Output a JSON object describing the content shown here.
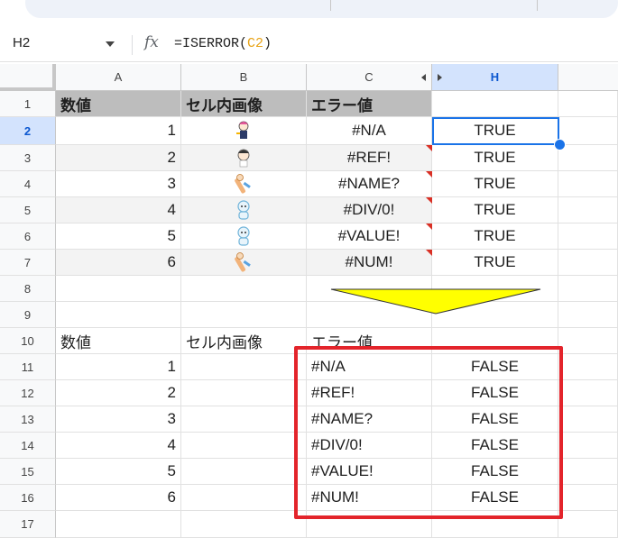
{
  "formula_bar": {
    "name_box": "H2",
    "fx_label": "fx",
    "formula_prefix": "=ISERROR(",
    "formula_ref": "C2",
    "formula_suffix": ")"
  },
  "columns": [
    "A",
    "B",
    "C",
    "H"
  ],
  "rows": [
    "1",
    "2",
    "3",
    "4",
    "5",
    "6",
    "7",
    "8",
    "9",
    "10",
    "11",
    "12",
    "13",
    "14",
    "15",
    "16",
    "17"
  ],
  "selected_cell": "H2",
  "table1": {
    "headers": [
      "数値",
      "セル内画像",
      "エラー値"
    ],
    "rows": [
      {
        "num": "1",
        "image": "anime-character-1",
        "error": "#N/A",
        "result": "TRUE"
      },
      {
        "num": "2",
        "image": "anime-character-2",
        "error": "#REF!",
        "result": "TRUE"
      },
      {
        "num": "3",
        "image": "anime-character-3",
        "error": "#NAME?",
        "result": "TRUE"
      },
      {
        "num": "4",
        "image": "robot-character",
        "error": "#DIV/0!",
        "result": "TRUE"
      },
      {
        "num": "5",
        "image": "robot-character",
        "error": "#VALUE!",
        "result": "TRUE"
      },
      {
        "num": "6",
        "image": "anime-character-3",
        "error": "#NUM!",
        "result": "TRUE"
      }
    ]
  },
  "table2": {
    "headers": [
      "数値",
      "セル内画像",
      "エラー値"
    ],
    "rows": [
      {
        "num": "1",
        "error": "#N/A",
        "result": "FALSE"
      },
      {
        "num": "2",
        "error": "#REF!",
        "result": "FALSE"
      },
      {
        "num": "3",
        "error": "#NAME?",
        "result": "FALSE"
      },
      {
        "num": "4",
        "error": "#DIV/0!",
        "result": "FALSE"
      },
      {
        "num": "5",
        "error": "#VALUE!",
        "result": "FALSE"
      },
      {
        "num": "6",
        "error": "#NUM!",
        "result": "FALSE"
      }
    ]
  },
  "colors": {
    "header_fill": "#bdbdbd",
    "band_fill": "#f3f3f3",
    "selection": "#1a73e8",
    "arrow_fill": "#ffff00",
    "highlight_box": "#e3242b",
    "note_marker": "#d93025"
  }
}
